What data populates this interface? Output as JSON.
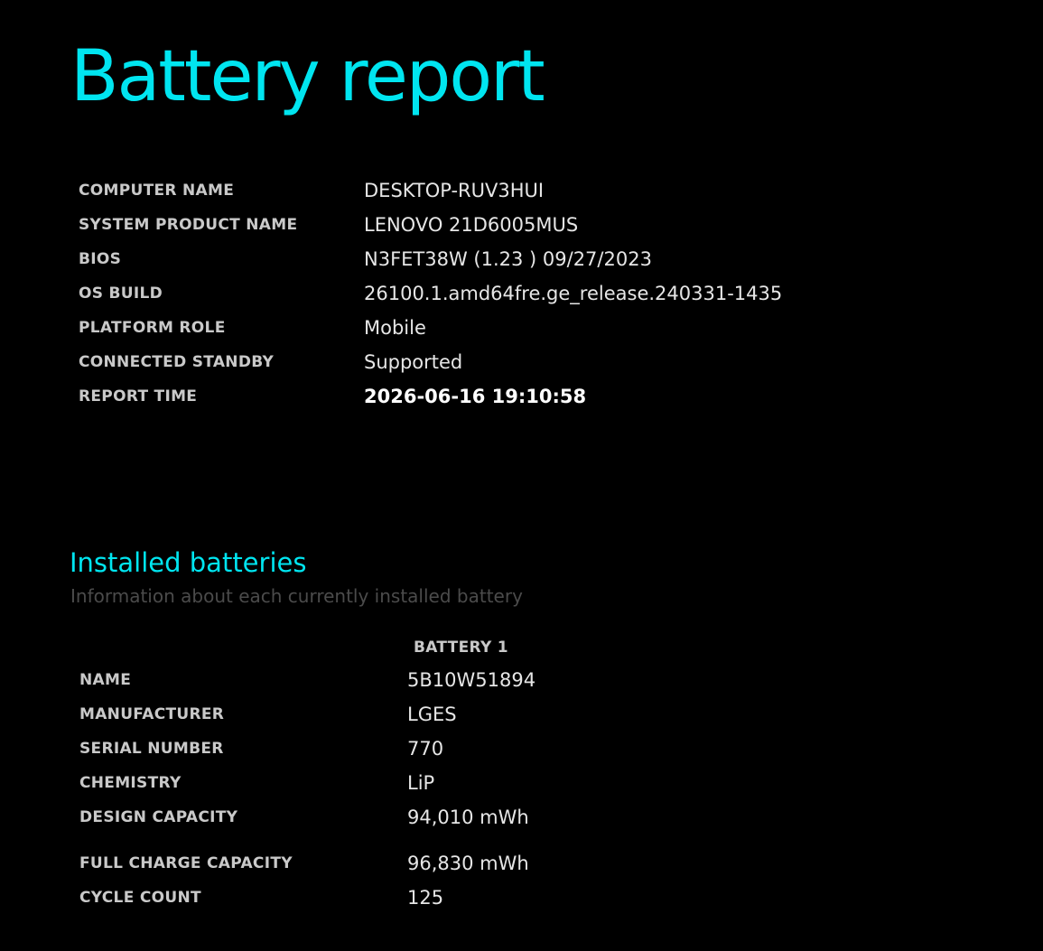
{
  "report": {
    "title": "Battery report",
    "system_info": [
      {
        "label": "COMPUTER NAME",
        "value": "DESKTOP-RUV3HUI"
      },
      {
        "label": "SYSTEM PRODUCT NAME",
        "value": "LENOVO 21D6005MUS"
      },
      {
        "label": "BIOS",
        "value": "N3FET38W (1.23 ) 09/27/2023"
      },
      {
        "label": "OS BUILD",
        "value": "26100.1.amd64fre.ge_release.240331-1435"
      },
      {
        "label": "PLATFORM ROLE",
        "value": "Mobile"
      },
      {
        "label": "CONNECTED STANDBY",
        "value": "Supported"
      },
      {
        "label": "REPORT TIME",
        "value": "2026-06-16  19:10:58"
      }
    ]
  },
  "installed_batteries": {
    "title": "Installed batteries",
    "subtitle": "Information about each currently installed battery",
    "column_header": "BATTERY 1",
    "rows": [
      {
        "label": "NAME",
        "value": "5B10W51894"
      },
      {
        "label": "MANUFACTURER",
        "value": "LGES"
      },
      {
        "label": "SERIAL NUMBER",
        "value": "770"
      },
      {
        "label": "CHEMISTRY",
        "value": "LiP"
      },
      {
        "label": "DESIGN CAPACITY",
        "value": "94,010 mWh"
      },
      {
        "label": "FULL CHARGE CAPACITY",
        "value": "96,830 mWh"
      },
      {
        "label": "CYCLE COUNT",
        "value": "125"
      }
    ]
  },
  "colors": {
    "background": "#000000",
    "accent": "#00e5f0",
    "label": "#c9c9c9",
    "value": "#e6e6e6",
    "subtitle": "#4b4b4b"
  }
}
